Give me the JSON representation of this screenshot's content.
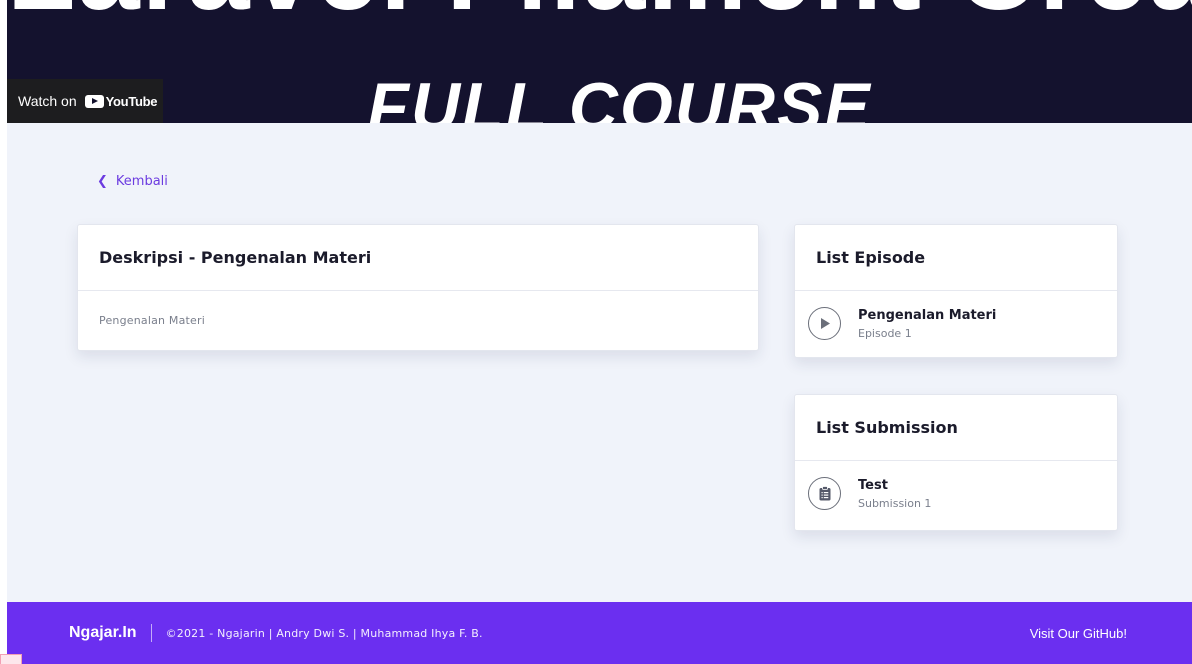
{
  "video": {
    "title_top": "Laravel Filament Create",
    "title_bottom": "FULL COURSE",
    "watch_label": "Watch on",
    "youtube_label": "YouTube"
  },
  "nav": {
    "back_label": "Kembali"
  },
  "description": {
    "title": "Deskripsi - Pengenalan Materi",
    "body": "Pengenalan Materi"
  },
  "episodes": {
    "title": "List Episode",
    "items": [
      {
        "title": "Pengenalan Materi",
        "subtitle": "Episode 1",
        "icon": "play-icon"
      }
    ]
  },
  "submissions": {
    "title": "List Submission",
    "items": [
      {
        "title": "Test",
        "subtitle": "Submission 1",
        "icon": "clipboard-icon"
      }
    ]
  },
  "footer": {
    "brand": "Ngajar.In",
    "copyright": "©2021 - Ngajarin | Andry Dwi S. | Muhammad Ihya F. B.",
    "github_label": "Visit Our GitHub!"
  },
  "colors": {
    "accent": "#6b2ff0",
    "link": "#6c3be0",
    "background": "#f0f3fa",
    "video_bg": "#14122e"
  }
}
